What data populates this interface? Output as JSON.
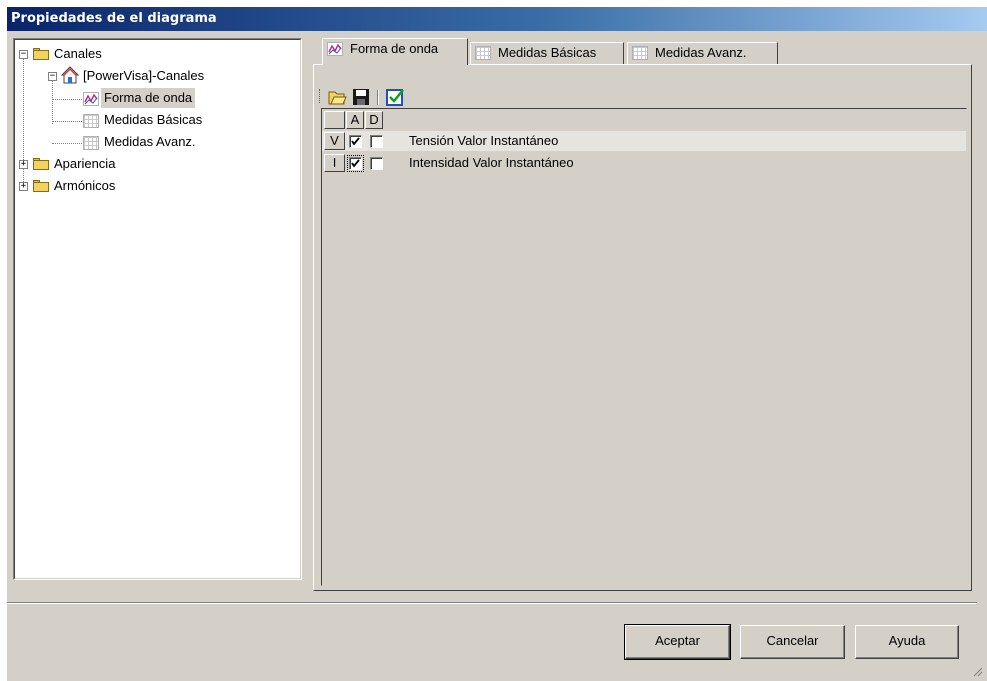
{
  "window": {
    "title": "Propiedades de el diagrama"
  },
  "tree": {
    "canales": "Canales",
    "powervisa": "[PowerVisa]-Canales",
    "forma": "Forma de onda",
    "basicas": "Medidas Básicas",
    "avanz": "Medidas Avanz.",
    "apariencia": "Apariencia",
    "armonicos": "Armónicos"
  },
  "tabs": [
    {
      "label": "Forma de onda",
      "active": true
    },
    {
      "label": "Medidas Básicas",
      "active": false
    },
    {
      "label": "Medidas Avanz.",
      "active": false
    }
  ],
  "toolbar": {
    "icons": [
      "open-folder-icon",
      "save-icon",
      "check-all-icon"
    ]
  },
  "list": {
    "headers": {
      "a": "A",
      "d": "D"
    },
    "rows": [
      {
        "key": "V",
        "a": true,
        "d": false,
        "label": "Tensión Valor Instantáneo"
      },
      {
        "key": "I",
        "a": true,
        "d": false,
        "label": "Intensidad Valor Instantáneo"
      }
    ]
  },
  "buttons": {
    "ok": "Aceptar",
    "cancel": "Cancelar",
    "help": "Ayuda"
  },
  "colors": {
    "titlebar_start": "#0a246a",
    "titlebar_end": "#a6caf0",
    "face": "#d4d0c8"
  }
}
